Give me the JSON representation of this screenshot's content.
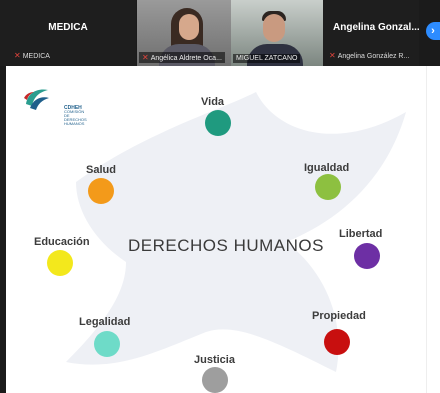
{
  "meeting": {
    "participants": [
      {
        "name": "MEDICA",
        "subtitle": "MEDICA"
      },
      {
        "label": "Angélica Aldrete Oca..."
      },
      {
        "label": "MIGUEL ZATCANO"
      },
      {
        "name": "Angelina Gonzal...",
        "subtitle": "Angelina González R..."
      }
    ]
  },
  "slide": {
    "title": "DERECHOS HUMANOS",
    "logo_text": [
      "CDHEH",
      "COMISIÓN DE",
      "DERECHOS",
      "HUMANOS"
    ],
    "rights": [
      {
        "label": "Vida",
        "color": "#1f9a7f"
      },
      {
        "label": "Salud",
        "color": "#f39a1a"
      },
      {
        "label": "Igualdad",
        "color": "#8dc040"
      },
      {
        "label": "Educación",
        "color": "#f3e81c"
      },
      {
        "label": "Libertad",
        "color": "#6d2fa4"
      },
      {
        "label": "Legalidad",
        "color": "#6edbc8"
      },
      {
        "label": "Propiedad",
        "color": "#c80f0f"
      },
      {
        "label": "Justicia",
        "color": "#9e9e9e"
      }
    ]
  }
}
